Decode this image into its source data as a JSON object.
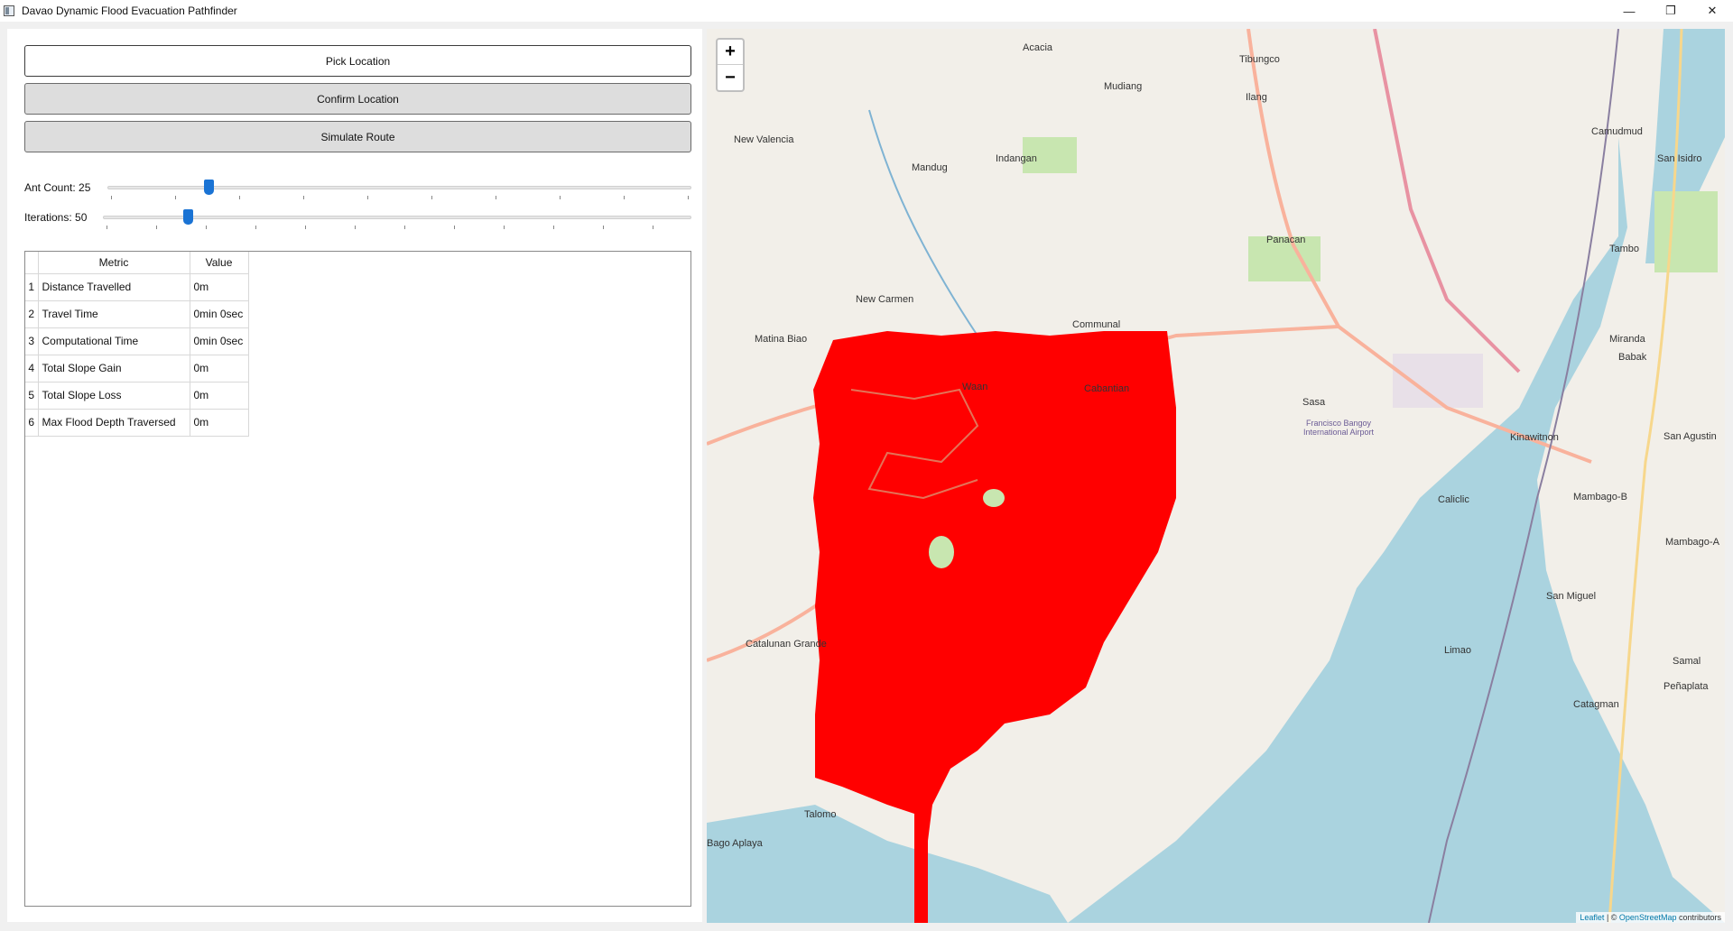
{
  "window": {
    "title": "Davao Dynamic Flood Evacuation Pathfinder",
    "controls": [
      "—",
      "❐",
      "✕"
    ]
  },
  "buttons": {
    "pick": "Pick Location",
    "confirm": "Confirm Location",
    "simulate": "Simulate Route"
  },
  "sliders": {
    "ant_count": {
      "label": "Ant Count: 25",
      "value": 25
    },
    "iterations": {
      "label": "Iterations: 50",
      "value": 50
    }
  },
  "table": {
    "headers": [
      "Metric",
      "Value"
    ],
    "rows": [
      {
        "idx": "1",
        "metric": "Distance Travelled",
        "value": "0m"
      },
      {
        "idx": "2",
        "metric": "Travel Time",
        "value": "0min 0sec"
      },
      {
        "idx": "3",
        "metric": "Computational Time",
        "value": "0min 0sec"
      },
      {
        "idx": "4",
        "metric": "Total Slope Gain",
        "value": "0m"
      },
      {
        "idx": "5",
        "metric": "Total Slope Loss",
        "value": "0m"
      },
      {
        "idx": "6",
        "metric": "Max Flood Depth Traversed",
        "value": "0m"
      }
    ]
  },
  "map": {
    "zoom_in": "+",
    "zoom_out": "−",
    "attribution_leaflet": "Leaflet",
    "attribution_sep": " | © ",
    "attribution_osm": "OpenStreetMap",
    "attribution_contrib": " contributors",
    "overlay_color": "#ff0000",
    "sea_color": "#aad3df",
    "labels": [
      "Acacia",
      "Tibungco",
      "Mudiang",
      "Ilang",
      "New Valencia",
      "Mandug",
      "Indangan",
      "Camudmud",
      "San Isidro",
      "Panacan",
      "Tambo",
      "New Carmen",
      "Communal",
      "Matina Biao",
      "Waan",
      "Cabantian",
      "Miranda",
      "Babak",
      "Sasa",
      "Kinawitnon",
      "San Agustin",
      "Caliclic",
      "Mambago-B",
      "Mambago-A",
      "San Miguel",
      "Catalunan Grande",
      "Limao",
      "Samal",
      "Catagman",
      "Peñaplata",
      "Talomo",
      "Bago Aplaya",
      "Francisco Bangoy International Airport"
    ]
  }
}
